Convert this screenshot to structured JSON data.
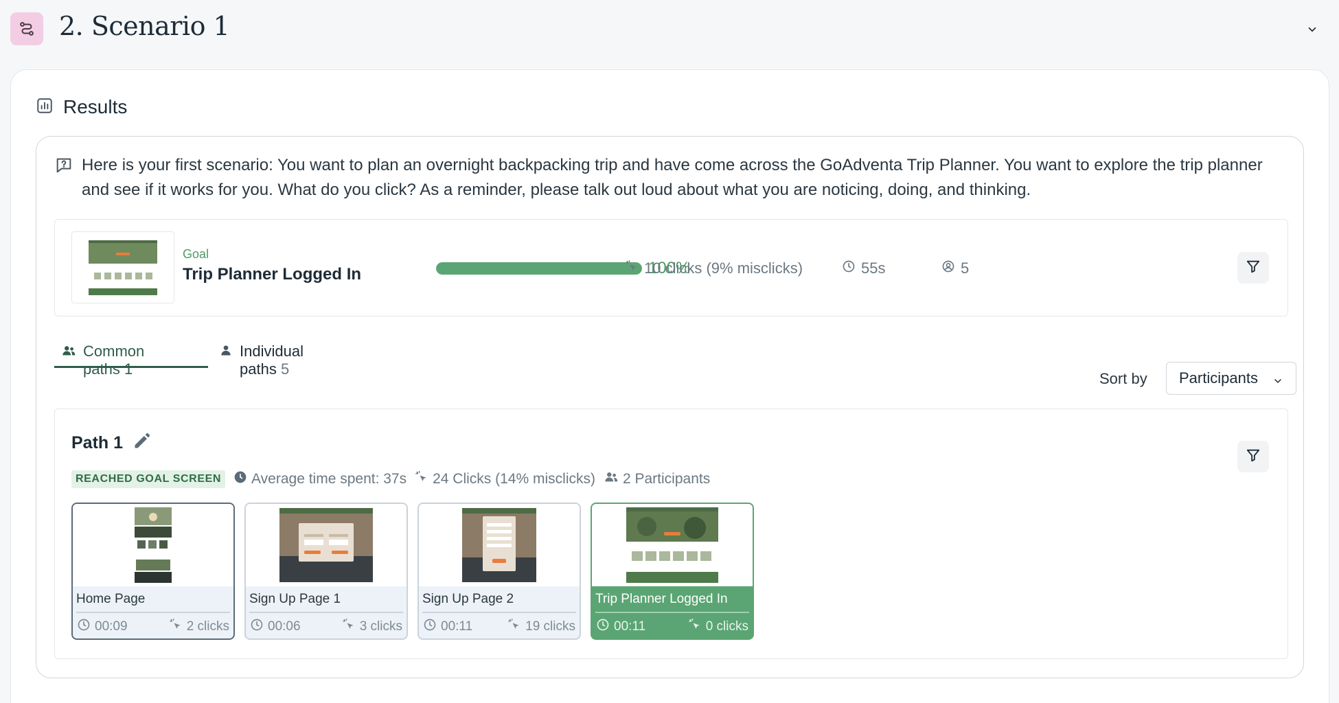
{
  "header": {
    "title": "2. Scenario 1",
    "icon": "path-icon"
  },
  "results": {
    "heading": "Results",
    "prompt": "Here is your first scenario: You want to plan an overnight backpacking trip and have come across the GoAdventa Trip Planner. You want to explore the trip planner and see if it works for you. What do you click? As a reminder, please talk out loud about what you are noticing, doing, and thinking."
  },
  "goal": {
    "label": "Goal",
    "title": "Trip Planner Logged In",
    "success_percent": 100,
    "success_label": "100%",
    "clicks": "10 clicks (9% misclicks)",
    "time": "55s",
    "participants": "5"
  },
  "tabs": [
    {
      "label": "Common paths",
      "count": "1",
      "active": true
    },
    {
      "label": "Individual paths",
      "count": "5",
      "active": false
    }
  ],
  "sort": {
    "label": "Sort by",
    "value": "Participants"
  },
  "path": {
    "title": "Path 1",
    "badge": "REACHED GOAL SCREEN",
    "avg_time": "Average time spent: 37s",
    "clicks": "24 Clicks (14% misclicks)",
    "participants": "2 Participants",
    "screens": [
      {
        "name": "Home Page",
        "time": "00:09",
        "clicks": "2 clicks"
      },
      {
        "name": "Sign Up Page 1",
        "time": "00:06",
        "clicks": "3 clicks"
      },
      {
        "name": "Sign Up Page 2",
        "time": "00:11",
        "clicks": "19 clicks"
      },
      {
        "name": "Trip Planner Logged In",
        "time": "00:11",
        "clicks": "0 clicks"
      }
    ]
  },
  "colors": {
    "accent_green": "#5aa573",
    "tab_underline": "#2f5d4a",
    "scenario_icon_bg": "#f3cde3"
  }
}
